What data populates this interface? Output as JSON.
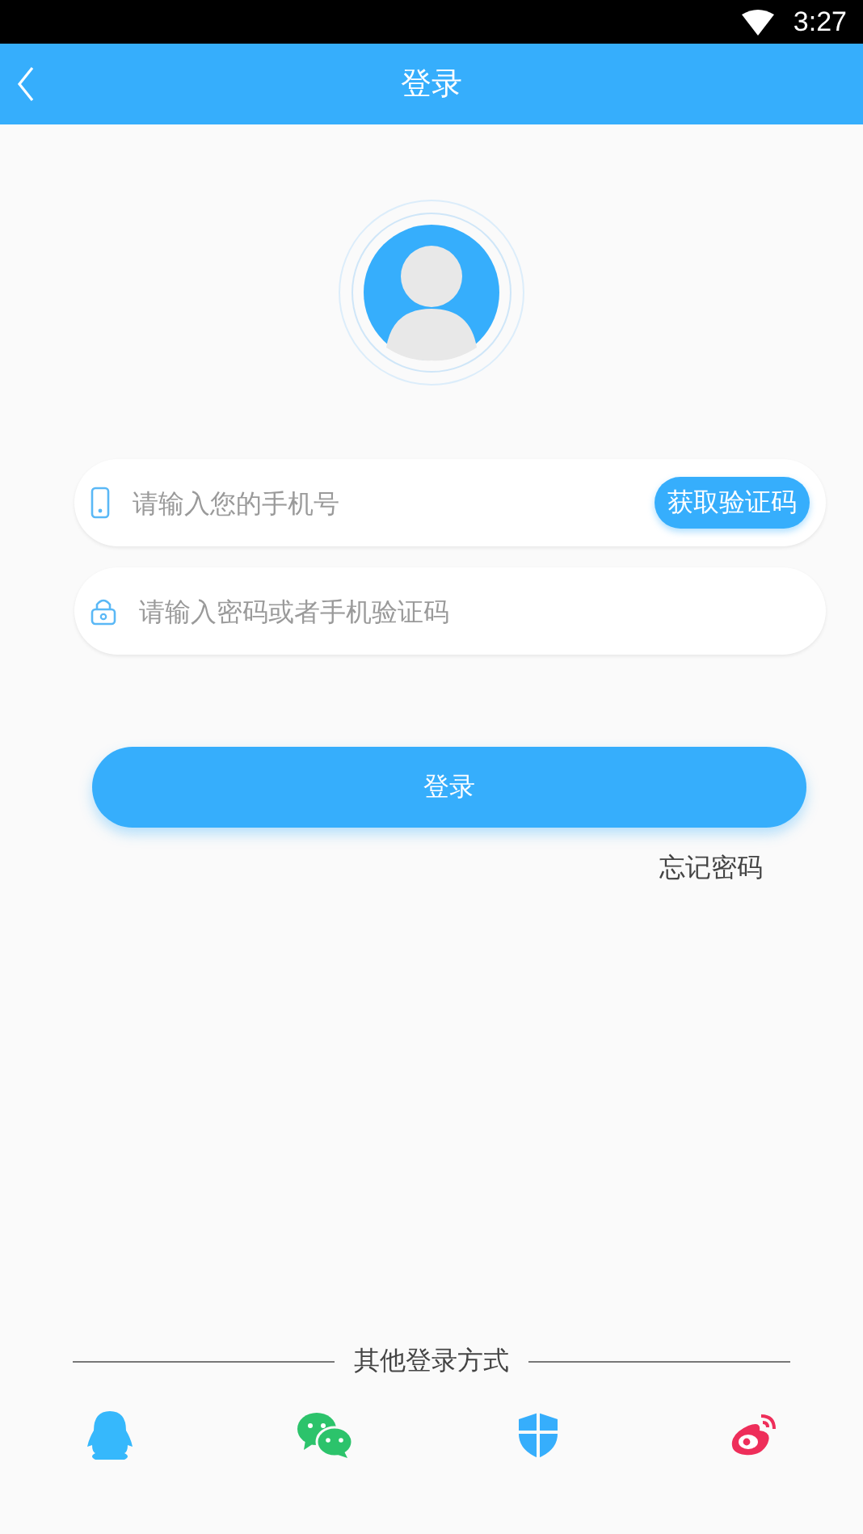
{
  "status_bar": {
    "time": "3:27"
  },
  "header": {
    "title": "登录"
  },
  "phone_field": {
    "placeholder": "请输入您的手机号"
  },
  "code_button": {
    "label": "获取验证码"
  },
  "password_field": {
    "placeholder": "请输入密码或者手机验证码"
  },
  "login_button": {
    "label": "登录"
  },
  "forgot_link": {
    "label": "忘记密码"
  },
  "other_login": {
    "title": "其他登录方式",
    "options": [
      {
        "kind": "qq"
      },
      {
        "kind": "wechat"
      },
      {
        "kind": "shield"
      },
      {
        "kind": "weibo"
      }
    ]
  }
}
